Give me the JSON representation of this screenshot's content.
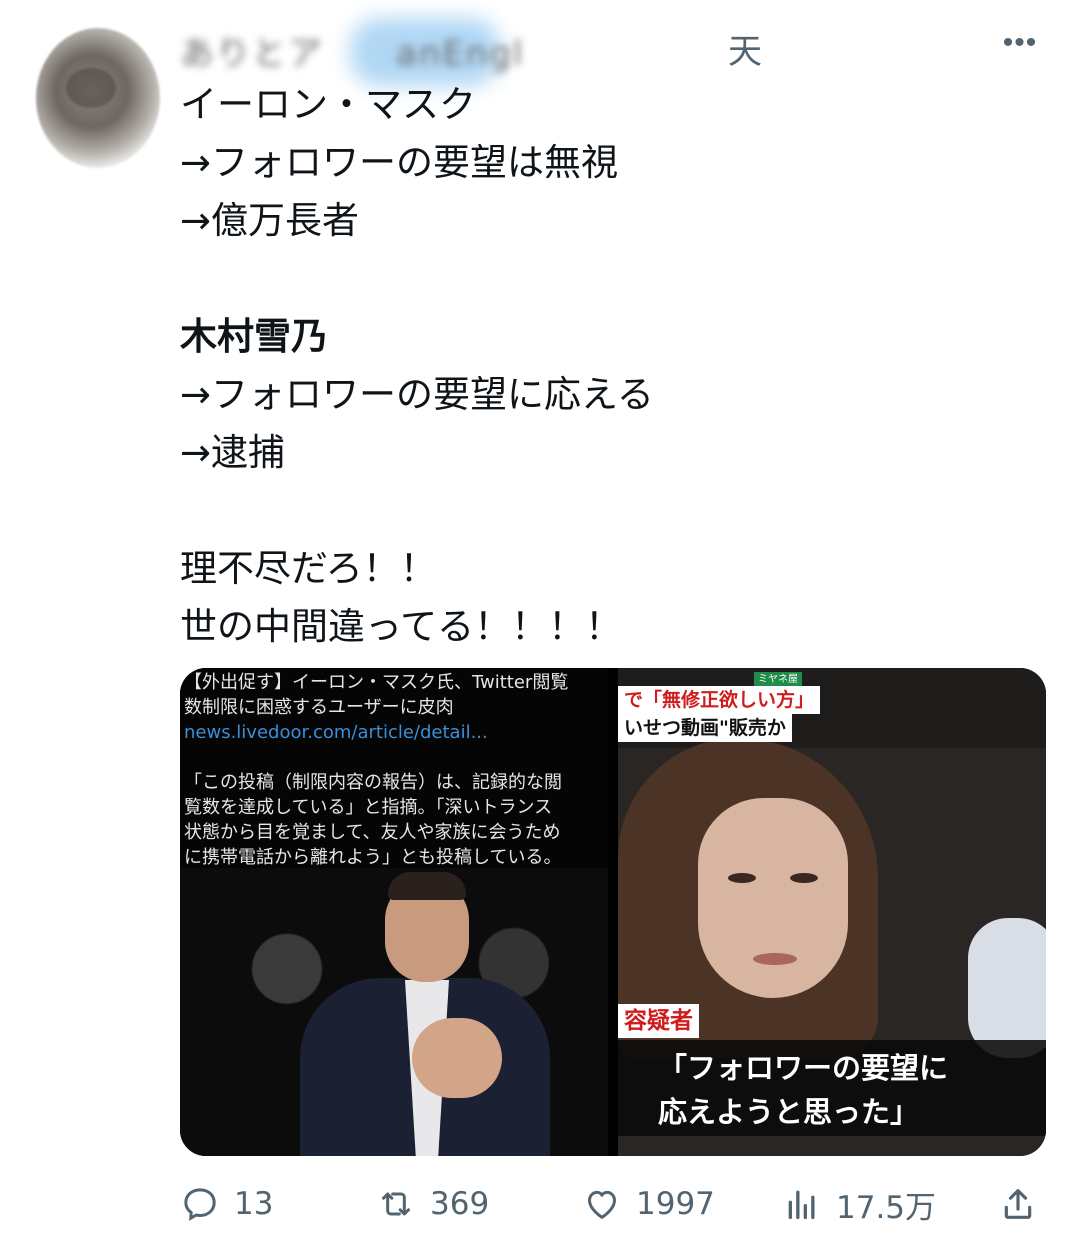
{
  "header": {
    "name_blurred": "ありとア　　anEngl　",
    "time": "天"
  },
  "body": {
    "lines": [
      "イーロン・マスク",
      "→フォロワーの要望は無視",
      "→億万長者",
      "木村雪乃",
      "→フォロワーの要望に応える",
      "→逮捕",
      "理不尽だろ！！",
      "世の中間違ってる！！！！"
    ]
  },
  "media": {
    "left": {
      "headline1": "【外出促す】イーロン・マスク氏、Twitter閲覧",
      "headline2": "数制限に困惑するユーザーに皮肉",
      "link": "news.livedoor.com/article/detail...",
      "quote1": "「この投稿（制限内容の報告）は、記録的な閲",
      "quote2": "覧数を達成している」と指摘。「深いトランス",
      "quote3": "状態から目を覚まして、友人や家族に会うため",
      "quote4": "に携帯電話から離れよう」とも投稿している。"
    },
    "right": {
      "tag": "ミヤネ屋",
      "label1": "で「無修正欲しい方」",
      "label2": "いせつ動画\"販売か",
      "suspect": "容疑者",
      "caption1": "「フォロワーの要望に",
      "caption2": "応えようと思った」"
    }
  },
  "actions": {
    "reply_count": "13",
    "retweet_count": "369",
    "like_count": "1997",
    "views_count": "17.5万"
  },
  "colors": {
    "text": "#0f1419",
    "muted": "#536471",
    "link": "#3b8fd8",
    "news_red": "#d01c1c"
  }
}
